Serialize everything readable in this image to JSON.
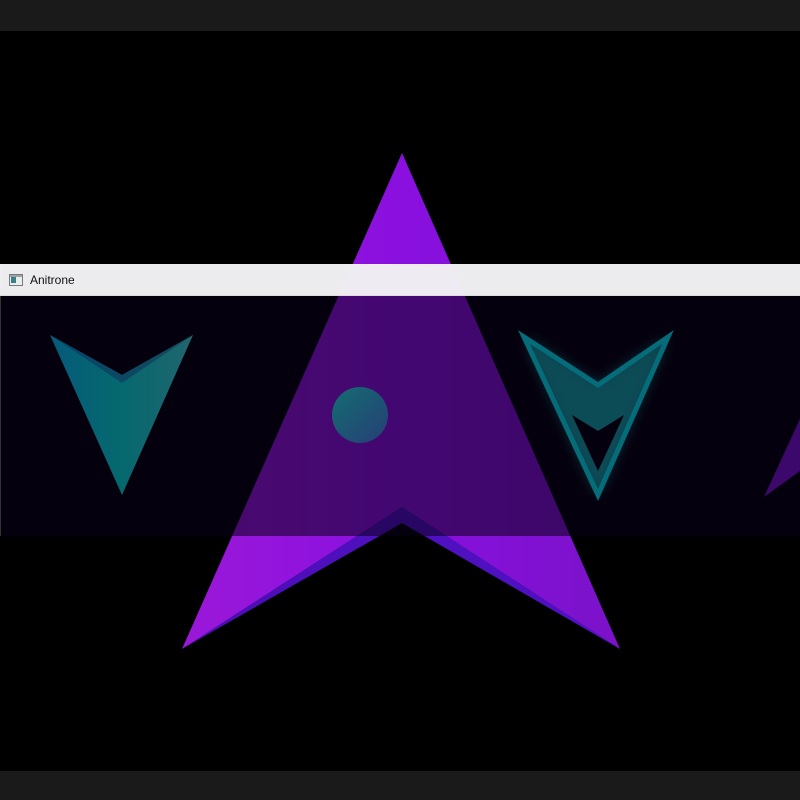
{
  "window": {
    "title": "Anitrone",
    "icon": "app-window-icon"
  },
  "colors": {
    "background": "#000000",
    "letterbox": "#1a1a1a",
    "player_purple": "#8a10e0",
    "enemy_cyan": "#00e5e0",
    "ball_cyan": "#2ee6e0",
    "titlebar": "#f6f6f8"
  },
  "scene": {
    "player": "purple-arrow-ship",
    "enemies": [
      "cyan-arrow-enemy",
      "cyan-glow-outline-enemy",
      "purple-arrow-enemy-offscreen"
    ],
    "projectile": "cyan-orb"
  }
}
